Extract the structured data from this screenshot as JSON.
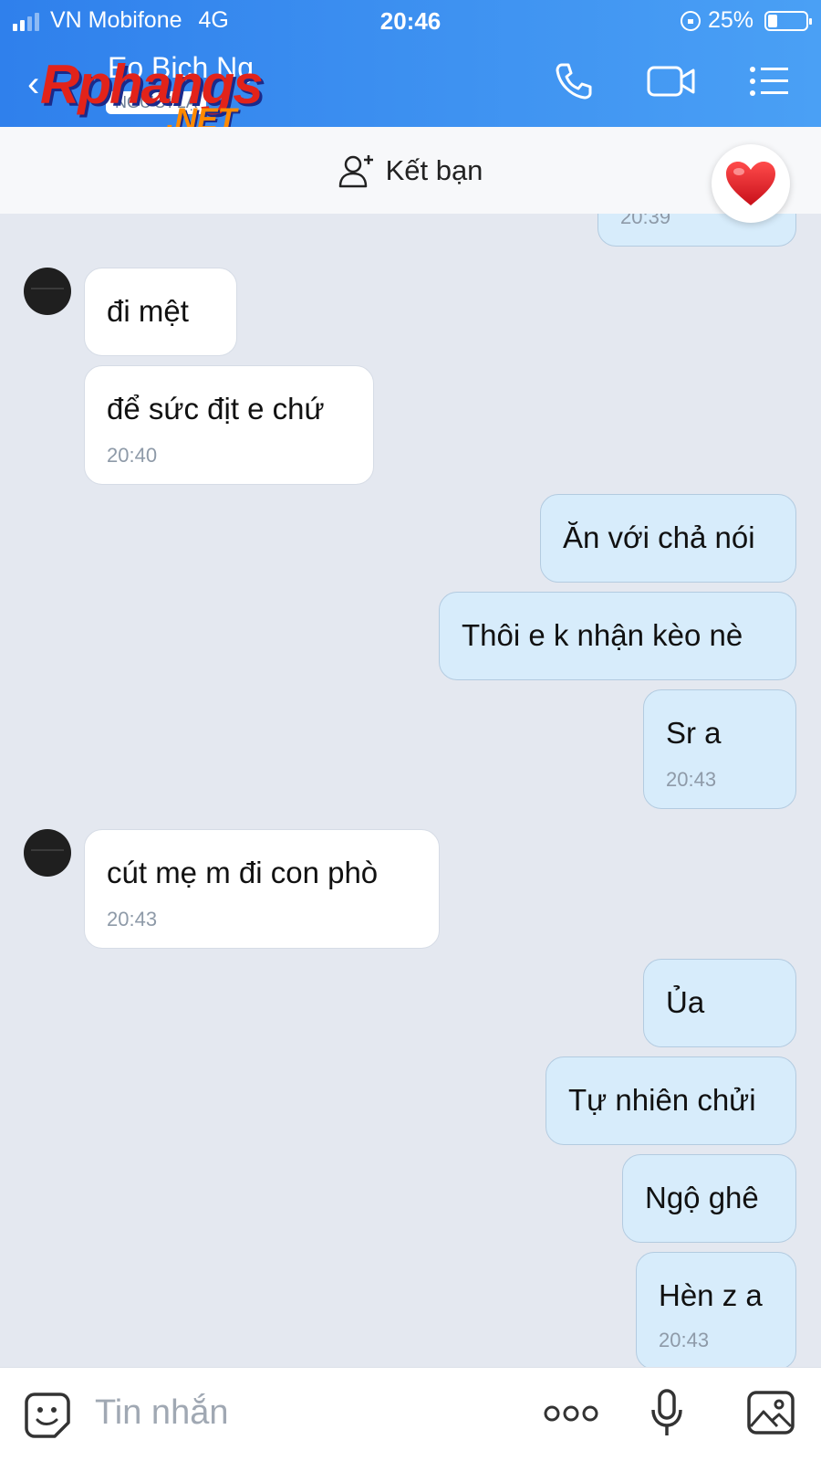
{
  "status_bar": {
    "carrier": "VN Mobifone",
    "network": "4G",
    "time": "20:46",
    "battery": "25%",
    "battery_level": 0.25
  },
  "header": {
    "contact_name": "Eo Bich Ng",
    "stranger_badge": "NGƯỜI LẠ",
    "watermark_main": "Rphangs",
    "watermark_net": ".NET",
    "icons": [
      "phone-icon",
      "video-call-icon",
      "menu-list-icon"
    ]
  },
  "friend_bar": {
    "label": "Kết bạn",
    "icon": "add-friend-icon",
    "heart_icon": "heart-icon"
  },
  "messages": {
    "m0": {
      "time": "20:39"
    },
    "m1": {
      "text": "đi mệt"
    },
    "m2": {
      "text": "để sức địt e chứ",
      "time": "20:40"
    },
    "m3": {
      "text": "Ăn với chả nói"
    },
    "m4": {
      "text": "Thôi e k nhận kèo nè"
    },
    "m5": {
      "text": "Sr a",
      "time": "20:43"
    },
    "m6": {
      "text": "cút mẹ m đi con phò",
      "time": "20:43"
    },
    "m7": {
      "text": "Ủa"
    },
    "m8": {
      "text": "Tự nhiên chửi"
    },
    "m9": {
      "text": "Ngộ ghê"
    },
    "m10": {
      "text": "Hèn z a",
      "time": "20:43"
    }
  },
  "input": {
    "placeholder": "Tin nhắn",
    "icons": [
      "sticker-icon",
      "more-icon",
      "microphone-icon",
      "image-icon"
    ]
  },
  "colors": {
    "header_blue": "#2f80ec",
    "incoming_bubble": "#ffffff",
    "outgoing_bubble": "#d7ecfb",
    "chat_background": "#e4e8f0"
  }
}
